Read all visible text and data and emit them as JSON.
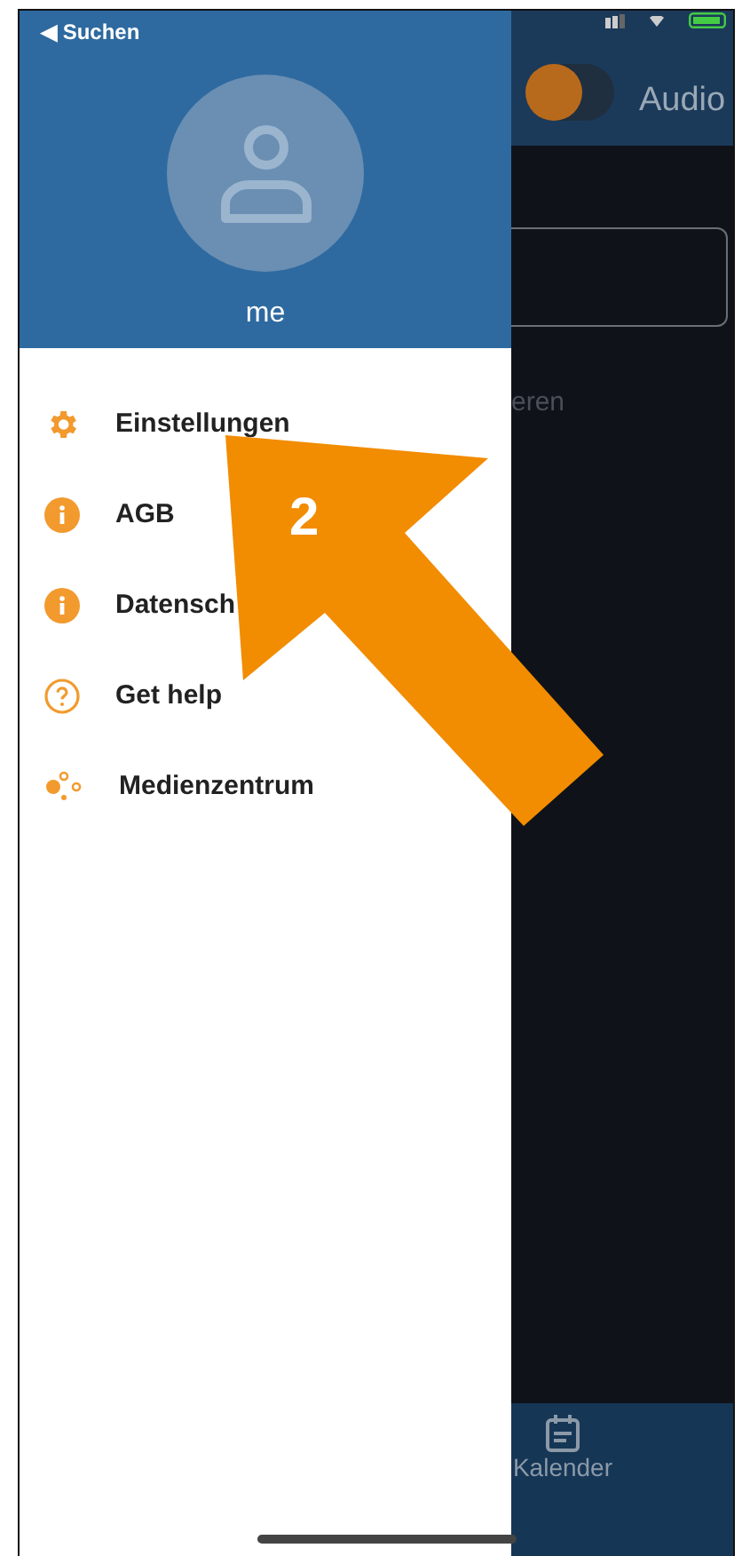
{
  "drawer": {
    "back_label": "◀ Suchen",
    "user_name": "me",
    "items": [
      {
        "kind": "settings",
        "label": "Einstellungen"
      },
      {
        "kind": "info",
        "label": "AGB"
      },
      {
        "kind": "info",
        "label": "Datensch"
      },
      {
        "kind": "help",
        "label": "Get help"
      },
      {
        "kind": "network",
        "label": "Medienzentrum"
      }
    ]
  },
  "background_app": {
    "toggle_on": false,
    "header_label": "Audio",
    "field_hint": "eren",
    "tab_label": "Kalender"
  },
  "annotation": {
    "label": "2"
  }
}
